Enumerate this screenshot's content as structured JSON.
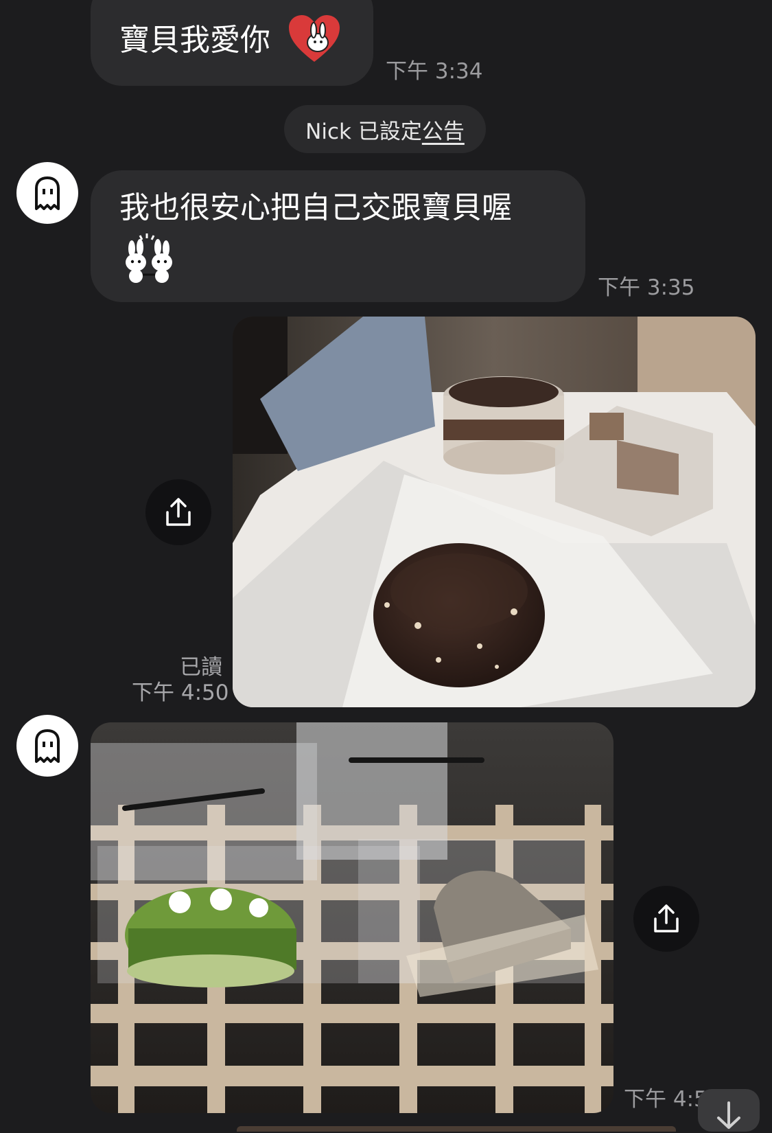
{
  "messages": {
    "m1": {
      "text": "寶貝我愛你",
      "sticker": "heart-bunny-sticker",
      "time": "下午 3:34"
    },
    "system": {
      "prefix": "Nick 已設定",
      "link": "公告"
    },
    "m2": {
      "line1": "我也很安心把自己交跟寶貝喔",
      "sticker": "bunny-pair-sticker",
      "time": "下午 3:35"
    },
    "m3": {
      "read": "已讀",
      "time": "下午 4:50",
      "content": "photo of desserts: chocolate cookie, tiramisu cup, wrapped cake"
    },
    "m4": {
      "time": "下午 4:5",
      "content": "photo of matcha roll cake and sesame chiffon cake in plastic containers"
    }
  },
  "icons": {
    "avatar": "ghost-icon",
    "share": "share-icon",
    "scroll": "arrow-down-icon"
  },
  "colors": {
    "background": "#1c1c1e",
    "bubble": "#2c2c2e",
    "timestamp": "#9c9c9f",
    "heart": "#d93a3a",
    "matcha": "#6f9a3a"
  }
}
